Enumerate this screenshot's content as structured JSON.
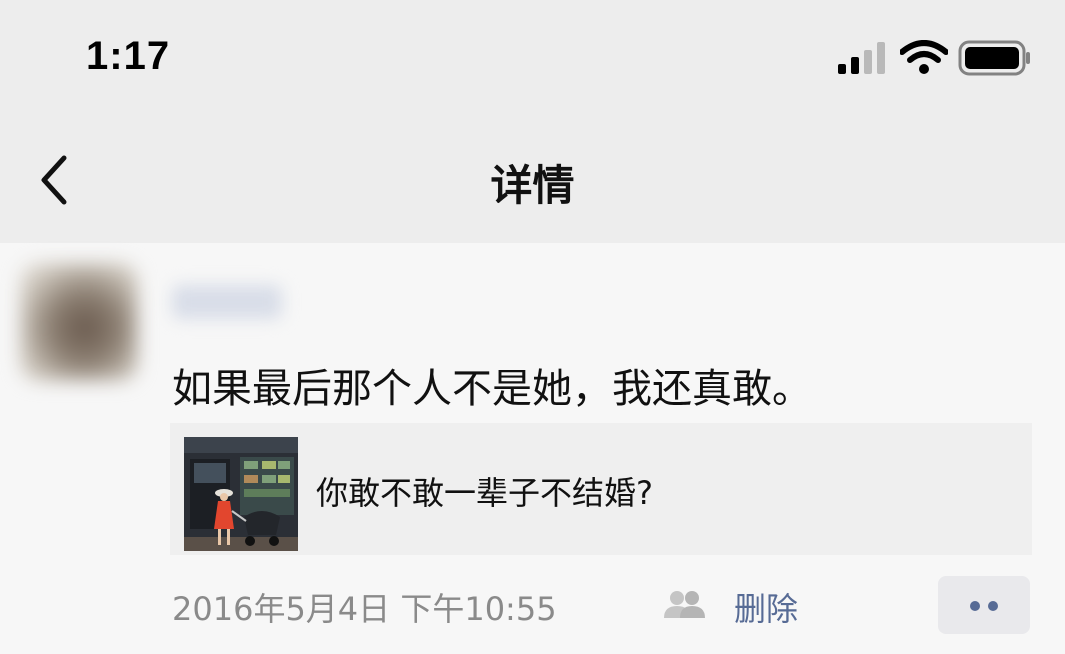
{
  "status_bar": {
    "time": "1:17"
  },
  "nav": {
    "title": "详情"
  },
  "post": {
    "text": "如果最后那个人不是她，我还真敢。",
    "share": {
      "title": "你敢不敢一辈子不结婚?"
    },
    "timestamp": "2016年5月4日 下午10:55",
    "delete_label": "删除"
  },
  "colors": {
    "link": "#576b95",
    "topbar_bg": "#ededed",
    "page_bg": "#f7f7f7",
    "timestamp": "#8a8a8a"
  },
  "icons": {
    "back": "chevron-left-icon",
    "signal": "cellular-signal-icon",
    "wifi": "wifi-icon",
    "battery": "battery-icon",
    "visibility": "friends-icon",
    "more": "more-dots-icon"
  }
}
